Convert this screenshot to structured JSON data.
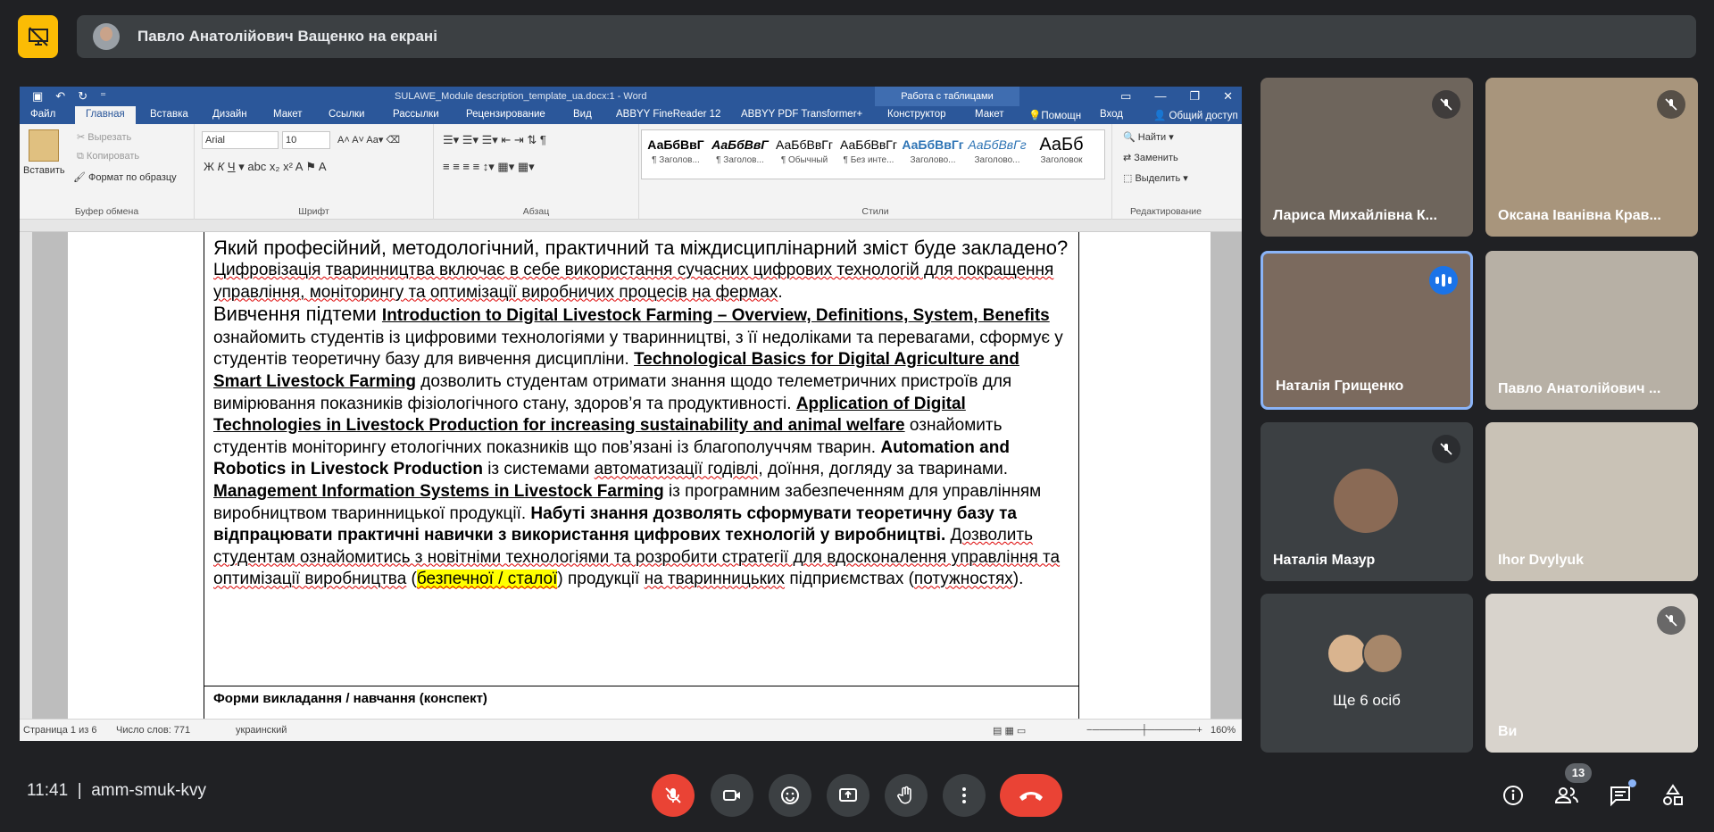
{
  "banner": {
    "presenter_text": "Павло Анатолійович Ващенко на екрані"
  },
  "word": {
    "title": "SULAWE_Module description_template_ua.docx:1 - Word",
    "table_tools": "Работа с таблицами",
    "tabs": [
      "Файл",
      "Главная",
      "Вставка",
      "Дизайн",
      "Макет",
      "Ссылки",
      "Рассылки",
      "Рецензирование",
      "Вид",
      "ABBYY FineReader 12",
      "ABBYY PDF Transformer+",
      "Конструктор",
      "Макет",
      "Помощн",
      "Вход",
      "Общий доступ"
    ],
    "clipboard": {
      "paste": "Вставить",
      "cut": "Вырезать",
      "copy": "Копировать",
      "format_painter": "Формат по образцу",
      "label": "Буфер обмена"
    },
    "font": {
      "name": "Arial",
      "size": "10",
      "label": "Шрифт"
    },
    "paragraph_label": "Абзац",
    "styles": {
      "label": "Стили",
      "items": [
        {
          "preview": "АаБбВвГ",
          "name": "¶ Заголов..."
        },
        {
          "preview": "АаБбВвГ",
          "name": "¶ Заголов..."
        },
        {
          "preview": "АаБбВвГг",
          "name": "¶ Обычный"
        },
        {
          "preview": "АаБбВвГг",
          "name": "¶ Без инте..."
        },
        {
          "preview": "АаБбВвГг",
          "name": "Заголово..."
        },
        {
          "preview": "АаБбВвГг",
          "name": "Заголово..."
        },
        {
          "preview": "АаБб",
          "name": "Заголовок"
        }
      ]
    },
    "editing": {
      "find": "Найти",
      "replace": "Заменить",
      "select": "Выделить",
      "label": "Редактирование"
    },
    "doc": {
      "heading": "Який професійний, методологічний, практичний та міждисциплінарний зміст буде закладено?",
      "para_cut": "Форми викладання / навчання (конспект)"
    },
    "status": {
      "page": "Страница 1 из 6",
      "words": "Число слов: 771",
      "lang": "украинский",
      "zoom": "160%"
    }
  },
  "participants": [
    {
      "name": "Лариса Михайлівна К...",
      "muted": true
    },
    {
      "name": "Оксана Іванівна Крав...",
      "muted": true
    },
    {
      "name": "Наталія Грищенко",
      "speaking": true
    },
    {
      "name": "Павло Анатолійович ...",
      "muted": false
    },
    {
      "name": "Наталія Мазур",
      "muted": true
    },
    {
      "name": "Ihor Dvylyuk",
      "muted": false
    },
    {
      "name": "Ще 6 осіб"
    },
    {
      "name": "Ви",
      "muted": true
    }
  ],
  "bottom": {
    "time": "11:41",
    "meeting_code": "amm-smuk-kvy",
    "participants_count": "13"
  },
  "colors": {
    "bg": "#202124",
    "tile": "#3c4043",
    "red": "#ea4335",
    "accent": "#8ab4f8",
    "present": "#fbbc04",
    "word_blue": "#2b579a"
  }
}
